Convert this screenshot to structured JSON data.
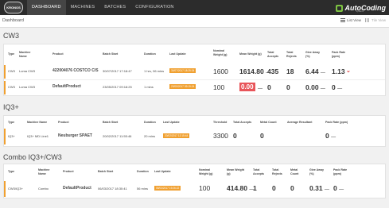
{
  "header": {
    "logo_text": "KRONOS",
    "tabs": [
      "DASHBOARD",
      "MACHINES",
      "BATCHES",
      "CONFIGURATION"
    ],
    "brand_name": "AutoCoding",
    "brand_sub": "Systems"
  },
  "subheader": {
    "breadcrumb": "Dashboard",
    "list_view": "List View",
    "tile_view": "Tile View"
  },
  "cw3": {
    "title": "CW3",
    "headers": [
      "Type",
      "Machine Name",
      "Product",
      "Batch Start",
      "Duration",
      "Last Update",
      "Nominal Weight (g)",
      "Mean Weight (g)",
      "Total Accepts",
      "Total Rejects",
      "Give Away (%)",
      "Pack Rate (ppm)"
    ],
    "rows": [
      {
        "type": "CW3",
        "machine": "Loma CW3",
        "product": "422004076 COSTCO C/S",
        "batch_start": "30/07/2017 17:18:47",
        "duration": "1 hrs, 06 mins",
        "last_update": "30/07/2017 18:25:34",
        "nominal": "1600",
        "mean": "1614.80",
        "accepts": "435",
        "rejects": "18",
        "give_away": "6.44",
        "pack_rate": "1.13"
      },
      {
        "type": "CW3",
        "machine": "Loma CW3",
        "product": "DefaultProduct",
        "batch_start": "23/05/2017 09:18:25",
        "duration": "1 mins",
        "last_update": "23/05/2017 09:19:24",
        "nominal": "100",
        "mean": "0.00",
        "accepts": "0",
        "rejects": "0",
        "give_away": "0.00",
        "pack_rate": "0"
      }
    ]
  },
  "iq3": {
    "title": "IQ3+",
    "headers": [
      "Type",
      "Machine Name",
      "Product",
      "Batch Start",
      "Duration",
      "Last Update",
      "Threshold",
      "Total Accepts",
      "Metal Count",
      "Average Resultant",
      "Pack Rate (ppm)"
    ],
    "rows": [
      {
        "type": "IQ3+",
        "machine": "IQ3+ MD Line1",
        "product": "Neuburger SPAET",
        "batch_start": "20/02/2017 11:55:46",
        "duration": "20 mins",
        "last_update": "20/02/2017 12:15:44",
        "threshold": "3300",
        "accepts": "0",
        "metal": "0",
        "avg": "",
        "pack_rate": "0"
      }
    ]
  },
  "combo": {
    "title": "Combo IQ3+/CW3",
    "headers": [
      "Type",
      "Machine Name",
      "Product",
      "Batch Start",
      "Duration",
      "Last Update",
      "Nominal Weight (g)",
      "Mean Weight (g)",
      "Total Accepts",
      "Total Rejects",
      "Metal Count",
      "Give Away (%)",
      "Pack Rate (ppm)"
    ],
    "rows": [
      {
        "type": "CW3/IQ3+",
        "machine": "Combo",
        "product": "DefaultProduct",
        "batch_start": "06/03/2017 18:30:41",
        "duration": "56 mins",
        "last_update": "06/03/2017 19:26:22",
        "nominal": "100",
        "mean": "414.80",
        "accepts": "1",
        "rejects": "0",
        "metal": "0",
        "give_away": "0.31",
        "pack_rate": "0"
      }
    ]
  },
  "dash": "—",
  "colors": {
    "accent": "#f0a030",
    "alert": "#e8555a",
    "brand": "#7dc242"
  }
}
